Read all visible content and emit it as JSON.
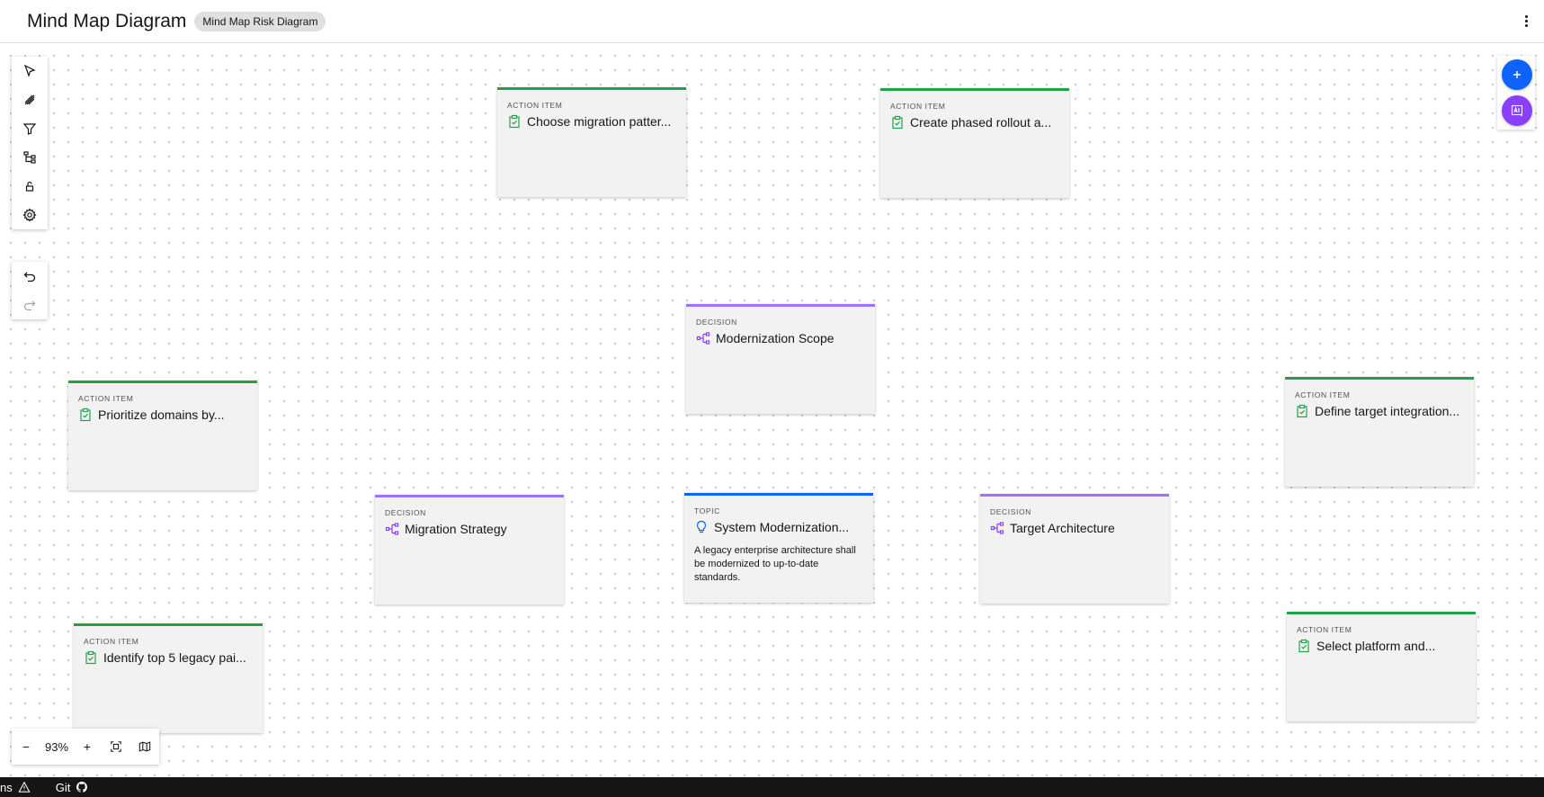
{
  "header": {
    "title": "Mind Map Diagram",
    "tag": "Mind Map Risk Diagram"
  },
  "toolbar": {
    "tools": [
      "select-icon",
      "pen-icon",
      "filter-icon",
      "tree-icon",
      "lock-icon",
      "settings-icon"
    ],
    "history": [
      "undo-icon",
      "redo-icon"
    ]
  },
  "nodes": [
    {
      "type": "ACTION ITEM",
      "title": "Choose migration patter...",
      "icon": "clipboard-check-icon"
    },
    {
      "type": "ACTION ITEM",
      "title": "Create phased rollout a...",
      "icon": "clipboard-check-icon"
    },
    {
      "type": "DECISION",
      "title": "Modernization Scope",
      "icon": "decision-tree-icon"
    },
    {
      "type": "ACTION ITEM",
      "title": "Prioritize domains by...",
      "icon": "clipboard-check-icon"
    },
    {
      "type": "ACTION ITEM",
      "title": "Define target integration...",
      "icon": "clipboard-check-icon"
    },
    {
      "type": "DECISION",
      "title": "Migration Strategy",
      "icon": "decision-tree-icon"
    },
    {
      "type": "TOPIC",
      "title": "System Modernization...",
      "icon": "lightbulb-icon",
      "description": "A legacy enterprise architecture shall be modernized to up-to-date standards."
    },
    {
      "type": "DECISION",
      "title": "Target Architecture",
      "icon": "decision-tree-icon"
    },
    {
      "type": "ACTION ITEM",
      "title": "Identify top 5 legacy pai...",
      "icon": "clipboard-check-icon"
    },
    {
      "type": "ACTION ITEM",
      "title": "Select platform and...",
      "icon": "clipboard-check-icon"
    }
  ],
  "zoom": {
    "minus": "−",
    "value": "93%",
    "plus": "+"
  },
  "statusbar": {
    "problems": "ns",
    "git": "Git"
  },
  "colors": {
    "action": "#24a148",
    "decision": "#a56eff",
    "topic": "#0f62fe",
    "fab_add": "#0f62fe",
    "fab_ai": "#8a3ffc"
  }
}
